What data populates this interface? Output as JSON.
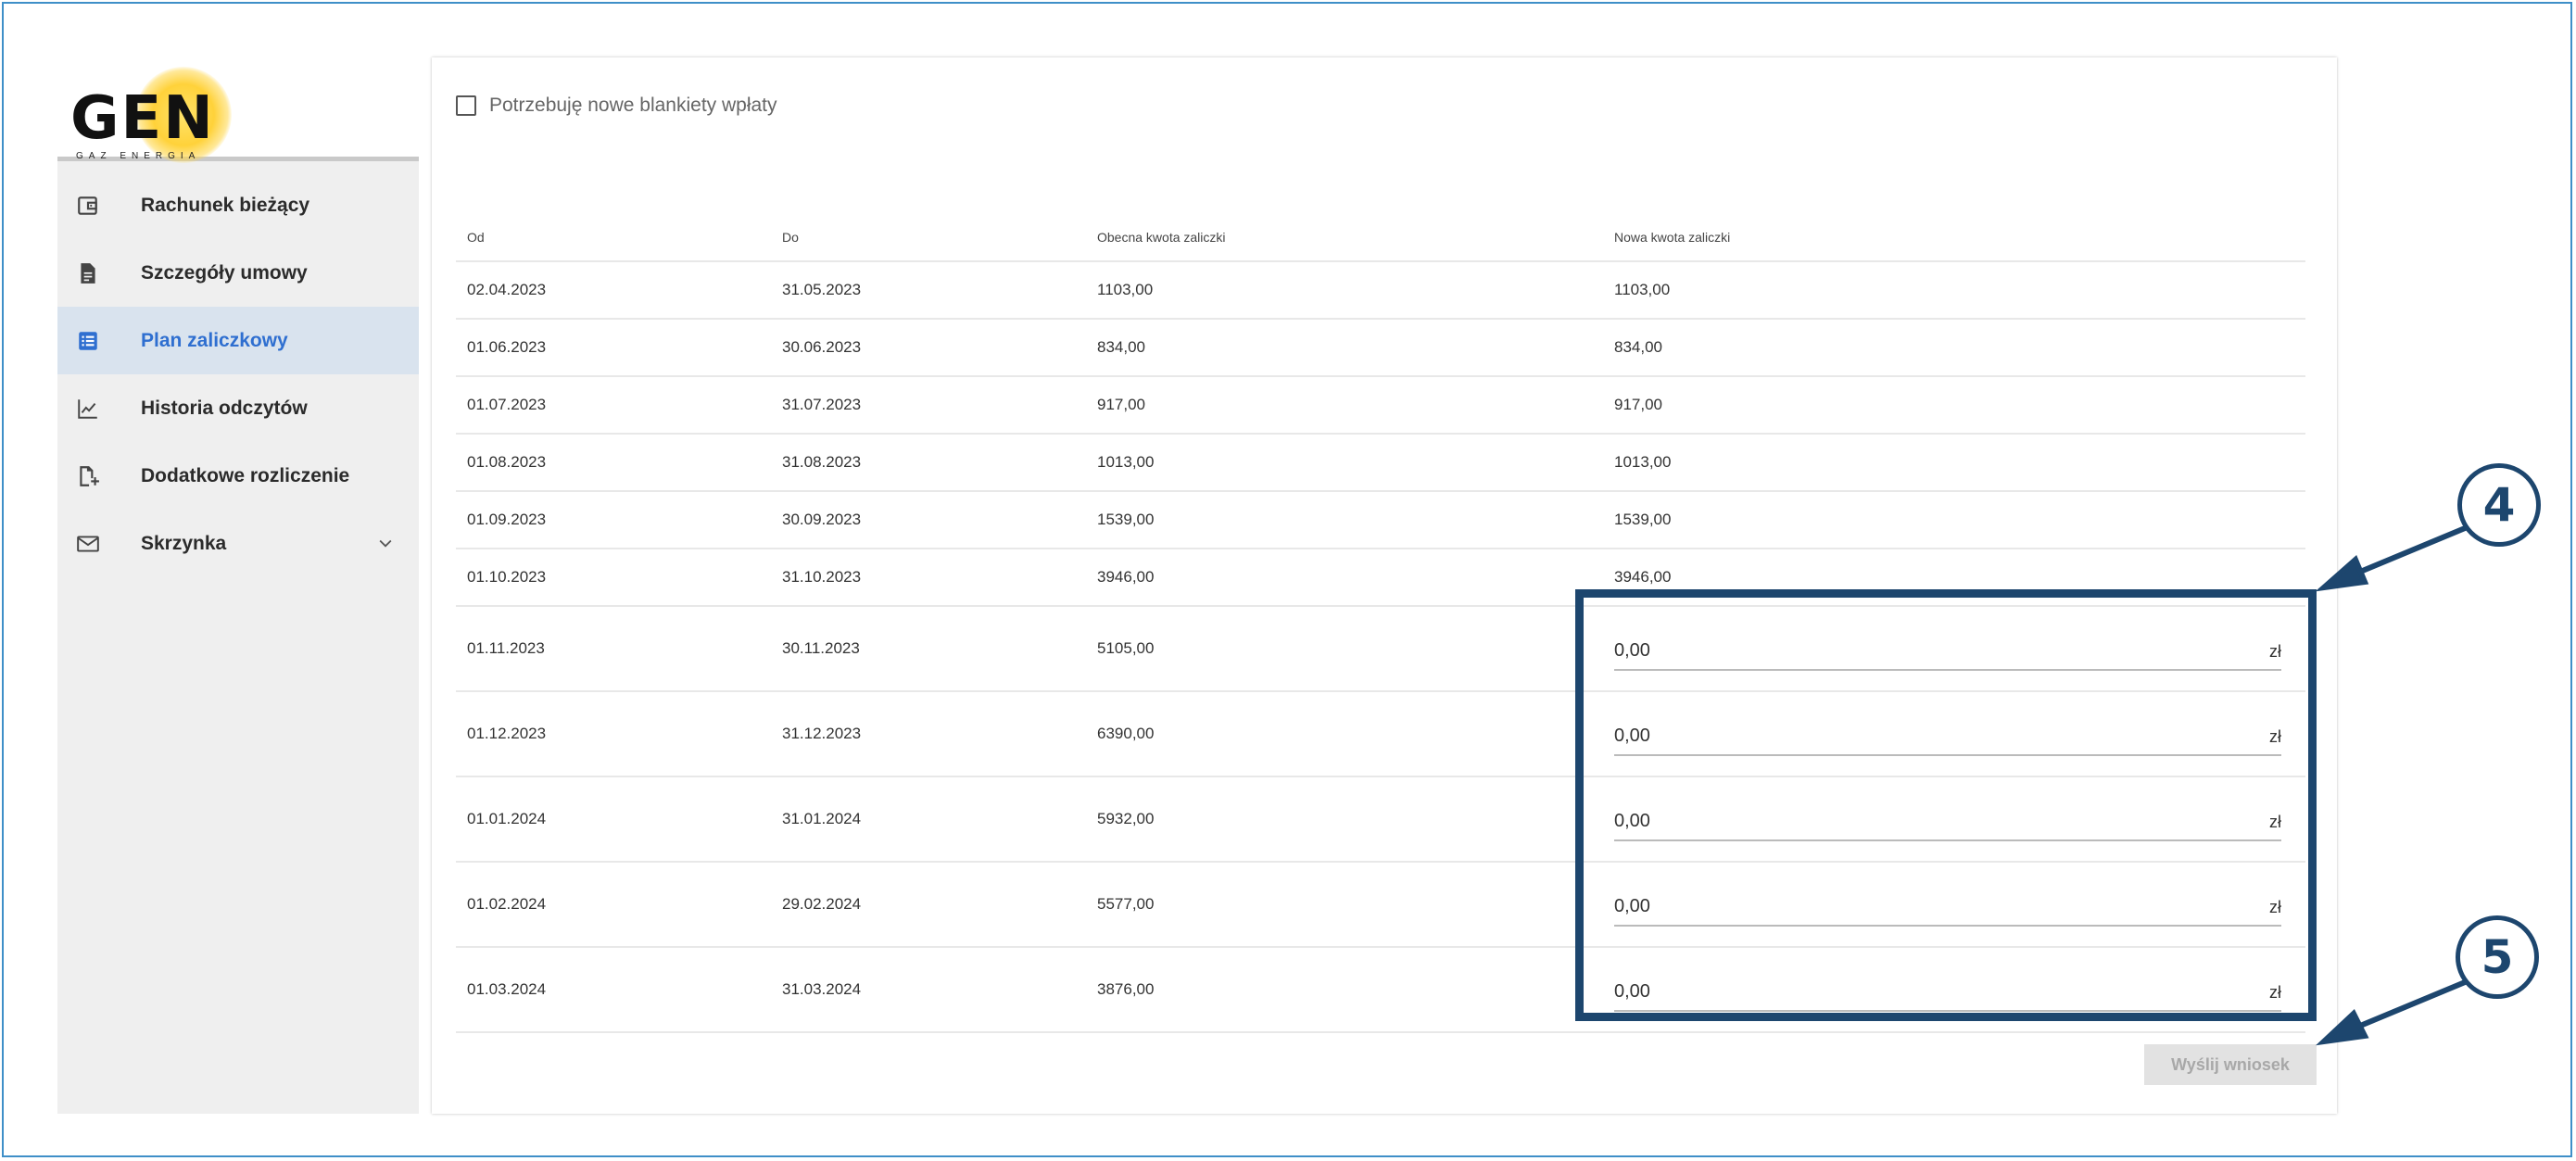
{
  "logo": {
    "text": "GEN",
    "subtitle": "GAZ ENERGIA",
    "sun_color": "#ffd23a"
  },
  "sidebar": {
    "items": [
      {
        "label": "Rachunek bieżący",
        "icon": "wallet-icon",
        "active": false
      },
      {
        "label": "Szczegóły umowy",
        "icon": "document-icon",
        "active": false
      },
      {
        "label": "Plan zaliczkowy",
        "icon": "list-icon",
        "active": true
      },
      {
        "label": "Historia odczytów",
        "icon": "chart-line-icon",
        "active": false
      },
      {
        "label": "Dodatkowe rozliczenie",
        "icon": "document-add-icon",
        "active": false
      },
      {
        "label": "Skrzynka",
        "icon": "mail-icon",
        "active": false,
        "expandable": true
      }
    ]
  },
  "main": {
    "checkbox": {
      "label": "Potrzebuję nowe blankiety wpłaty",
      "checked": false
    },
    "table": {
      "headers": {
        "od": "Od",
        "do": "Do",
        "obecna": "Obecna kwota zaliczki",
        "nowa": "Nowa kwota zaliczki"
      },
      "rows": [
        {
          "od": "02.04.2023",
          "do": "31.05.2023",
          "obecna": "1103,00",
          "nowa": "1103,00"
        },
        {
          "od": "01.06.2023",
          "do": "30.06.2023",
          "obecna": "834,00",
          "nowa": "834,00"
        },
        {
          "od": "01.07.2023",
          "do": "31.07.2023",
          "obecna": "917,00",
          "nowa": "917,00"
        },
        {
          "od": "01.08.2023",
          "do": "31.08.2023",
          "obecna": "1013,00",
          "nowa": "1013,00"
        },
        {
          "od": "01.09.2023",
          "do": "30.09.2023",
          "obecna": "1539,00",
          "nowa": "1539,00"
        },
        {
          "od": "01.10.2023",
          "do": "31.10.2023",
          "obecna": "3946,00",
          "nowa": "3946,00"
        },
        {
          "od": "01.11.2023",
          "do": "30.11.2023",
          "obecna": "5105,00",
          "input": "0,00",
          "unit": "zł"
        },
        {
          "od": "01.12.2023",
          "do": "31.12.2023",
          "obecna": "6390,00",
          "input": "0,00",
          "unit": "zł"
        },
        {
          "od": "01.01.2024",
          "do": "31.01.2024",
          "obecna": "5932,00",
          "input": "0,00",
          "unit": "zł"
        },
        {
          "od": "01.02.2024",
          "do": "29.02.2024",
          "obecna": "5577,00",
          "input": "0,00",
          "unit": "zł"
        },
        {
          "od": "01.03.2024",
          "do": "31.03.2024",
          "obecna": "3876,00",
          "input": "0,00",
          "unit": "zł"
        }
      ]
    },
    "submit_label": "Wyślij wniosek"
  },
  "annotations": {
    "badge_4": "4",
    "badge_5": "5",
    "color": "#1d466e"
  },
  "colors": {
    "accent": "#2f6fd0",
    "active_bg": "#d9e3ee",
    "sidebar_bg": "#efefef",
    "frame": "#3f8fc8"
  }
}
